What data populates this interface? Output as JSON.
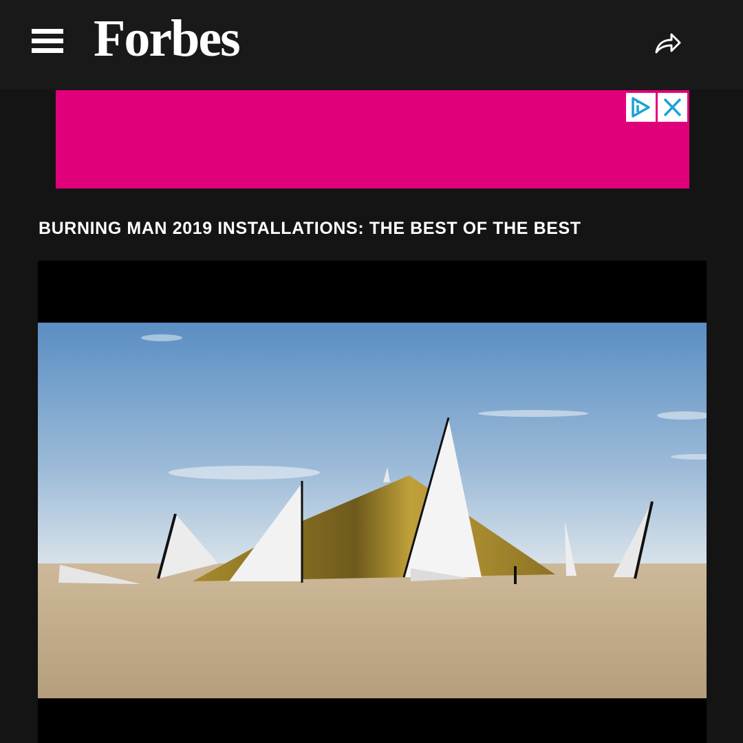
{
  "header": {
    "menu_icon": "hamburger-menu-icon",
    "logo_text": "Forbes",
    "share_icon": "share-arrow-icon"
  },
  "ad": {
    "background_color": "#e0007a",
    "choices_icon": "ad-choices-icon",
    "close_icon": "close-icon"
  },
  "article": {
    "headline": "BURNING MAN 2019 INSTALLATIONS: THE BEST OF THE BEST"
  },
  "media": {
    "description_icon": "landscape-photo"
  },
  "colors": {
    "header_bg": "#1a1919",
    "page_bg": "#141414",
    "accent_ad": "#e0007a",
    "ad_icon_blue": "#1aa3d4"
  }
}
